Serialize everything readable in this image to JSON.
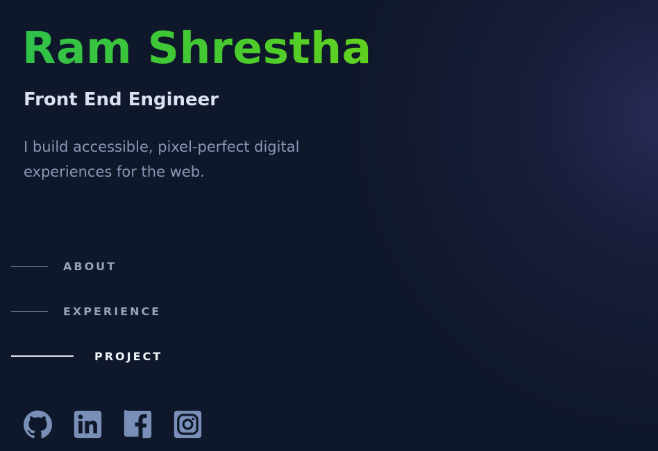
{
  "header": {
    "name": "Ram Shrestha",
    "role": "Front End Engineer",
    "tagline": "I build accessible, pixel-perfect digital experiences for the web."
  },
  "nav": {
    "items": [
      {
        "label": "ABOUT",
        "active": false
      },
      {
        "label": "EXPERIENCE",
        "active": false
      },
      {
        "label": "PROJECT",
        "active": true
      }
    ]
  },
  "socials": [
    {
      "icon": "github-icon"
    },
    {
      "icon": "linkedin-icon"
    },
    {
      "icon": "facebook-icon"
    },
    {
      "icon": "instagram-icon"
    }
  ],
  "colors": {
    "background": "#0f172a",
    "name_gradient_start": "#2fc14a",
    "name_gradient_end": "#62d11f",
    "heading": "#dbe1ee",
    "muted": "#8a97b5",
    "icon": "#7a8fb8",
    "active": "#f1f5f9"
  }
}
